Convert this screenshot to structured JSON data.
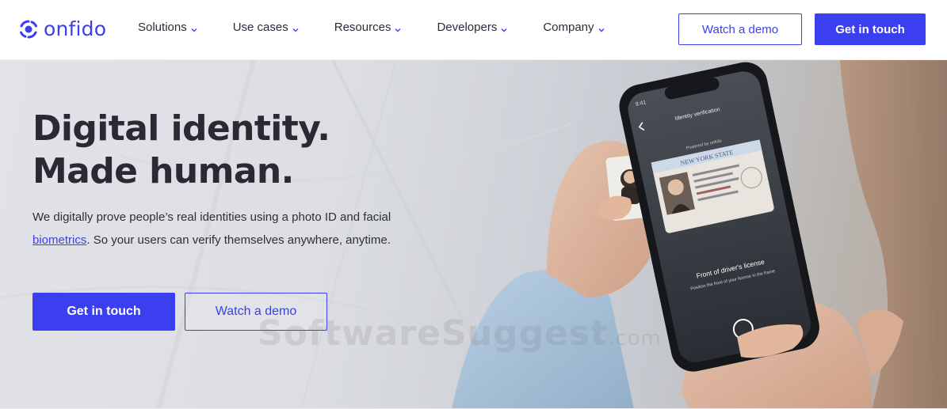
{
  "brand": {
    "name": "onfido",
    "accent": "#3b3ff0"
  },
  "nav": {
    "menu": [
      {
        "label": "Solutions"
      },
      {
        "label": "Use cases"
      },
      {
        "label": "Resources"
      },
      {
        "label": "Developers"
      },
      {
        "label": "Company"
      }
    ],
    "watch_demo": "Watch a demo",
    "get_in_touch": "Get in touch"
  },
  "hero": {
    "headline_line1": "Digital identity.",
    "headline_line2": "Made human.",
    "sub_part1": "We digitally prove people’s real identities using a photo ID and facial ",
    "sub_link": "biometrics",
    "sub_part2": ". So your users can verify themselves anywhere, anytime.",
    "primary_cta": "Get in touch",
    "secondary_cta": "Watch a demo"
  },
  "phone": {
    "time": "9:41",
    "screen_title": "Identity verification",
    "powered_by": "Powered by onfido",
    "license_state": "NEW YORK STATE",
    "instruction_title": "Front of driver's license",
    "instruction_sub": "Position the front of your license in the frame"
  },
  "watermark": {
    "main": "SoftwareSuggest",
    "suffix": ".com"
  },
  "icons": {
    "logo": "onfido-logo-icon",
    "chevron": "chevron-down-icon",
    "back": "back-arrow-icon",
    "shutter": "shutter-icon"
  }
}
